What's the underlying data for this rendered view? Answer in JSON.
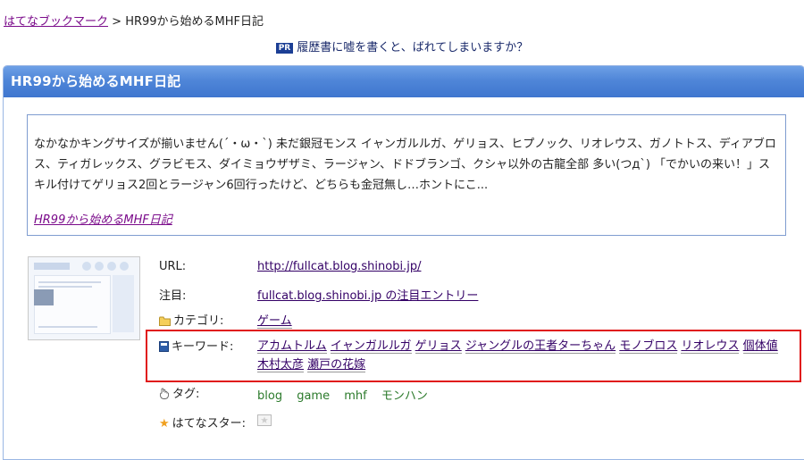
{
  "breadcrumb": {
    "root_label": "はてなブックマーク",
    "separator": ">",
    "current": "HR99から始めるMHF日記"
  },
  "pr": {
    "badge": "PR",
    "text": "履歴書に嘘を書くと、ばれてしまいますか？"
  },
  "entry": {
    "title": "HR99から始めるMHF日記",
    "summary": "なかなかキングサイズが揃いません(´・ω・`) 未だ銀冠モンス イャンガルルガ、ゲリョス、ヒプノック、リオレウス、ガノトトス、ディアブロス、ティガレックス、グラビモス、ダイミョウザザミ、ラージャン、ドドブランゴ、クシャ以外の古龍全部 多い(つд`) 「でかいの来い！」スキル付けてゲリョス2回とラージャン6回行ったけど、どちらも金冠無し…ホントにこ...",
    "summary_link": "HR99から始めるMHF日記",
    "info": {
      "url_label": "URL:",
      "url_value": "http://fullcat.blog.shinobi.jp/",
      "attention_label": "注目:",
      "attention_value": "fullcat.blog.shinobi.jp の注目エントリー",
      "category_label": "カテゴリ:",
      "category_value": "ゲーム",
      "keyword_label": "キーワード:",
      "keywords": [
        "アカムトルム",
        "イャンガルルガ",
        "ゲリョス",
        "ジャングルの王者ターちゃん",
        "モノブロス",
        "リオレウス",
        "個体値",
        "木村太彦",
        "瀬戸の花嫁"
      ],
      "tags_label": "タグ:",
      "tags": [
        "blog",
        "game",
        "mhf",
        "モンハン"
      ],
      "star_label": "はてなスター:"
    }
  },
  "colors": {
    "header_blue": "#4f86d8",
    "highlight_red": "#e01818",
    "tag_green": "#2b7a2b"
  },
  "icons": [
    "folder-icon",
    "keyword-icon",
    "tag-hand-icon",
    "star-icon",
    "add-star-icon"
  ]
}
